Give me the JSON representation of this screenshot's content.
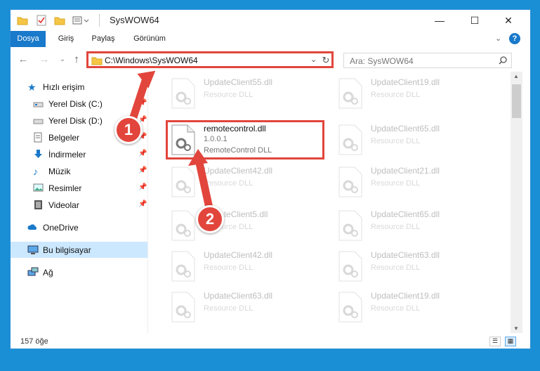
{
  "window": {
    "title": "SysWOW64",
    "minimize": "—",
    "maximize": "☐",
    "close": "✕"
  },
  "ribbon": {
    "tabs": [
      "Dosya",
      "Giriş",
      "Paylaş",
      "Görünüm"
    ],
    "help": "?"
  },
  "address": {
    "path": "C:\\Windows\\SysWOW64",
    "search_placeholder": "Ara: SysWOW64"
  },
  "nav": {
    "quick_access": "Hızlı erişim",
    "items": [
      {
        "label": "Yerel Disk (C:)",
        "pinned": true
      },
      {
        "label": "Yerel Disk (D:)",
        "pinned": true
      },
      {
        "label": "Belgeler",
        "pinned": true
      },
      {
        "label": "İndirmeler",
        "pinned": true
      },
      {
        "label": "Müzik",
        "pinned": true
      },
      {
        "label": "Resimler",
        "pinned": true
      },
      {
        "label": "Videolar",
        "pinned": true
      }
    ],
    "onedrive": "OneDrive",
    "this_pc": "Bu bilgisayar",
    "network": "Ağ"
  },
  "files": [
    {
      "name": "UpdateClient55.dll",
      "sub": "Resource DLL",
      "faded": true
    },
    {
      "name": "UpdateClient19.dll",
      "sub": "Resource DLL",
      "faded": true
    },
    {
      "name": "remotecontrol.dll",
      "version": "1.0.0.1",
      "sub": "RemoteControl DLL",
      "faded": false
    },
    {
      "name": "UpdateClient65.dll",
      "sub": "Resource DLL",
      "faded": true
    },
    {
      "name": "UpdateClient42.dll",
      "sub": "Resource DLL",
      "faded": true
    },
    {
      "name": "UpdateClient21.dll",
      "sub": "Resource DLL",
      "faded": true
    },
    {
      "name": "UpdateClient5.dll",
      "sub": "Resource DLL",
      "faded": true
    },
    {
      "name": "UpdateClient65.dll",
      "sub": "Resource DLL",
      "faded": true
    },
    {
      "name": "UpdateClient42.dll",
      "sub": "Resource DLL",
      "faded": true
    },
    {
      "name": "UpdateClient63.dll",
      "sub": "Resource DLL",
      "faded": true
    },
    {
      "name": "UpdateClient63.dll",
      "sub": "Resource DLL",
      "faded": true
    },
    {
      "name": "UpdateClient19.dll",
      "sub": "Resource DLL",
      "faded": true
    }
  ],
  "status": {
    "count": "157 öğe"
  },
  "annotations": {
    "step1": "1",
    "step2": "2",
    "color": "#e2453c"
  },
  "colors": {
    "accent": "#1979ca",
    "selected": "#cce8ff",
    "highlight": "#e2453c"
  }
}
